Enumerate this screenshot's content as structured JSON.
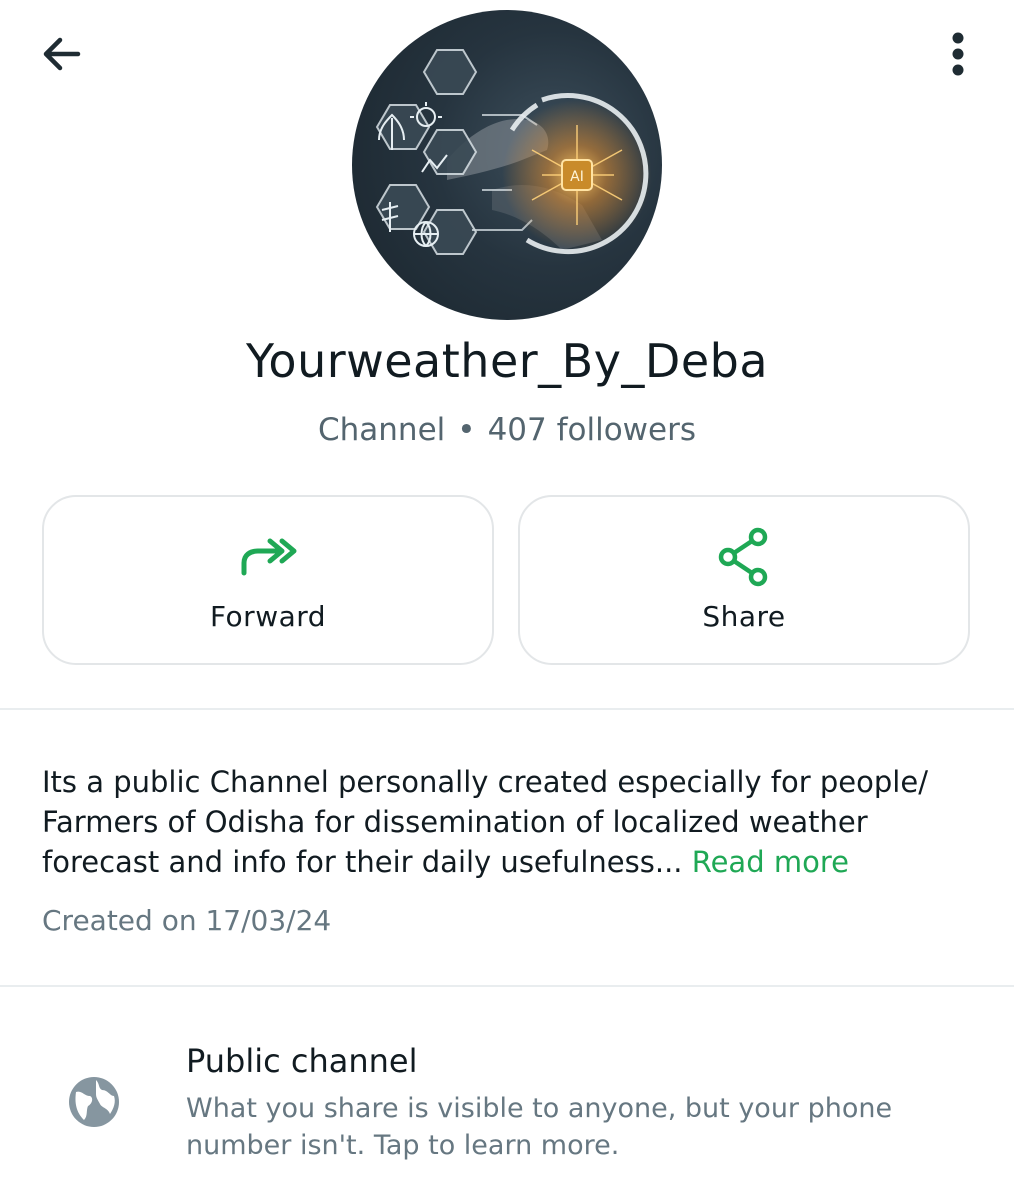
{
  "header": {
    "back_icon": "arrow-left-icon",
    "menu_icon": "more-vertical-icon"
  },
  "channel": {
    "avatar_description": "channel-avatar",
    "name": "Yourweather_By_Deba",
    "type": "Channel",
    "separator": "•",
    "followers": "407 followers"
  },
  "actions": [
    {
      "label": "Forward",
      "icon": "forward-icon"
    },
    {
      "label": "Share",
      "icon": "share-icon"
    }
  ],
  "about": {
    "text": "Its a public Channel personally created especially for people/ Farmers of Odisha for dissemination of localized weather forecast and info for their daily usefulness...",
    "read_more": "Read more",
    "created": "Created on 17/03/24"
  },
  "privacy": {
    "icon": "globe-icon",
    "title": "Public channel",
    "description": "What you share is visible to anyone, but your phone number isn't. Tap to learn more."
  },
  "colors": {
    "accent": "#1fa855",
    "text_primary": "#111b21",
    "text_secondary": "#667781",
    "card_border": "#e3e6e8"
  }
}
